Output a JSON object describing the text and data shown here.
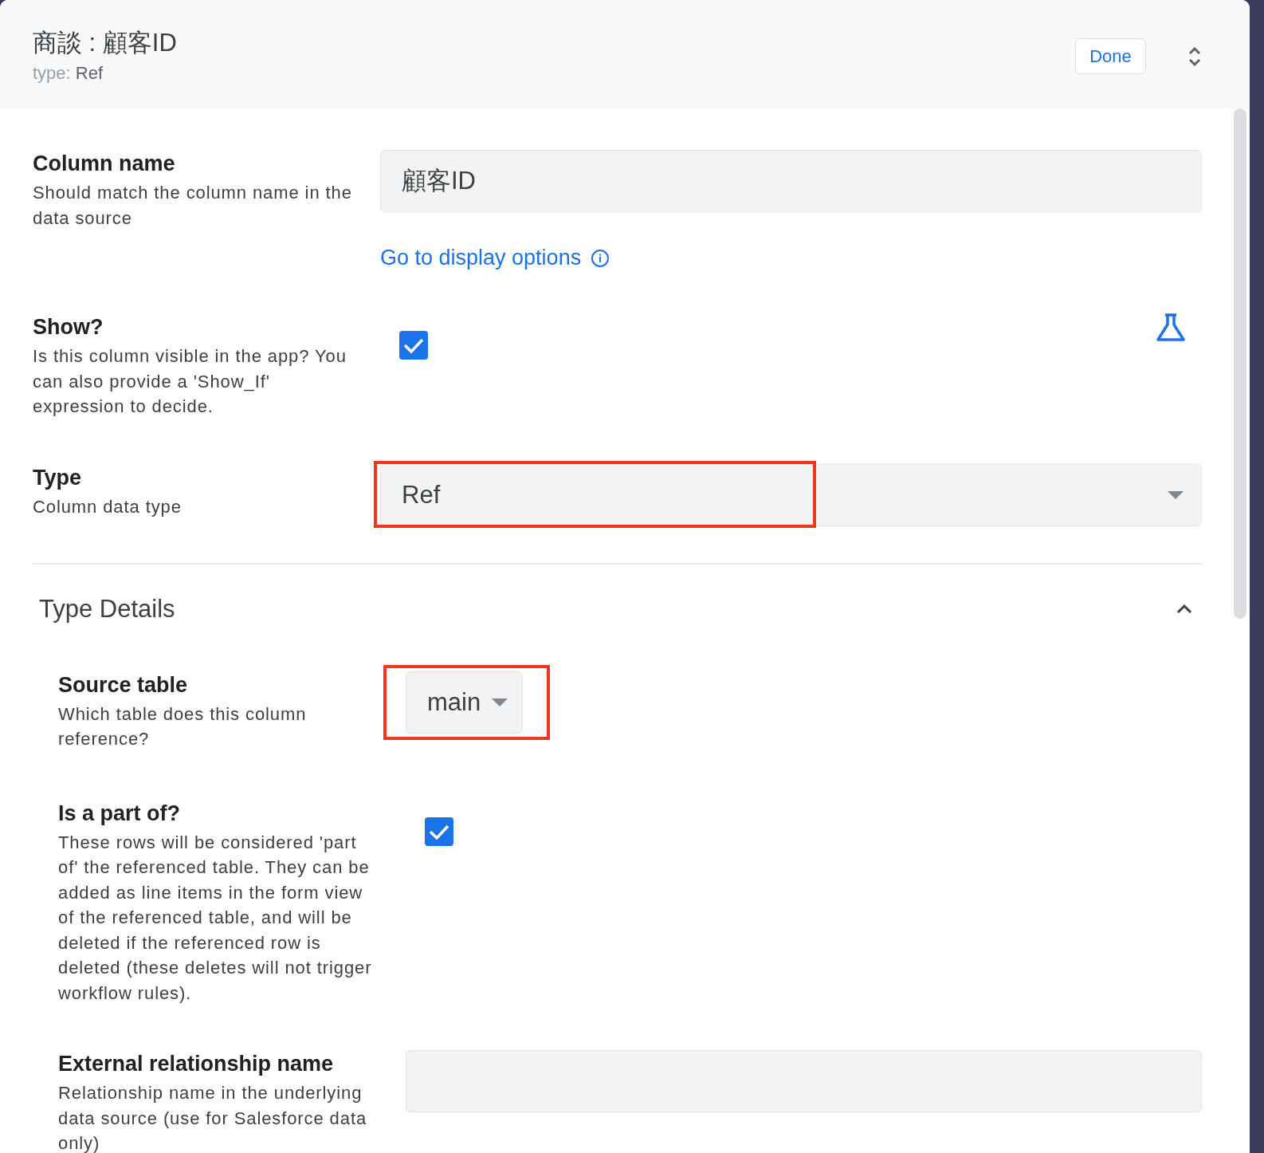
{
  "header": {
    "title": "商談 : 顧客ID",
    "type_label": "type:",
    "type_value": "Ref",
    "done_button": "Done"
  },
  "settings": [
    {
      "kind": "text",
      "label": "Column name",
      "description": "Should match the column name in the data source",
      "value": "顧客ID",
      "highlighted": false,
      "link": "Go to display options"
    },
    {
      "kind": "checkbox",
      "label": "Show?",
      "description": "Is this column visible in the app? You can also provide a 'Show_If' expression to decide.",
      "checked": true,
      "formula_button": true
    },
    {
      "kind": "select",
      "label": "Type",
      "description": "Column data type",
      "value": "Ref",
      "highlighted": true
    }
  ],
  "type_details": {
    "title": "Type Details",
    "expanded": true,
    "settings": [
      {
        "kind": "dropdown",
        "label": "Source table",
        "description": "Which table does this column reference?",
        "value": "main",
        "highlighted": true
      },
      {
        "kind": "checkbox",
        "label": "Is a part of?",
        "description": "These rows will be considered 'part of' the referenced table. They can be added as line items in the form view of the referenced table, and will be deleted if the referenced row is deleted (these deletes will not trigger workflow rules).",
        "checked": true,
        "formula_button": false
      },
      {
        "kind": "text",
        "label": "External relationship name",
        "description": "Relationship name in the underlying data source (use for Salesforce data only)",
        "highlighted": false
      }
    ]
  }
}
